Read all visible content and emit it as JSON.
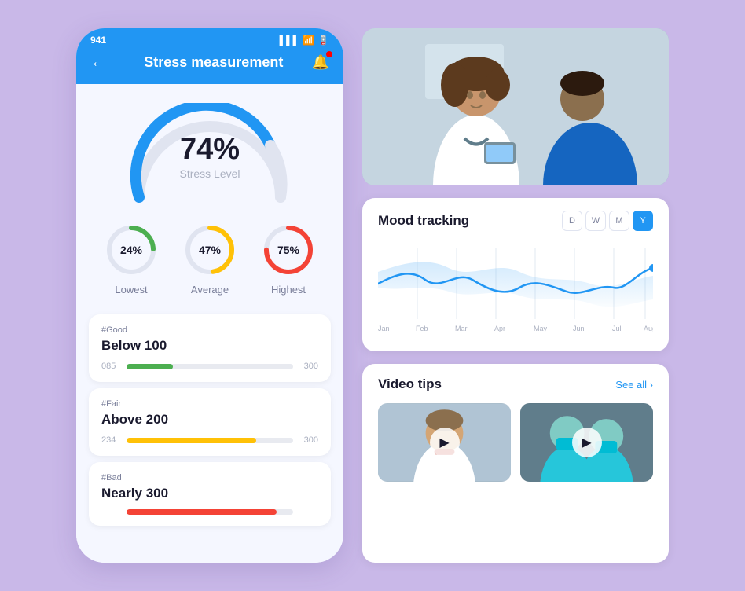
{
  "phone": {
    "status_time": "941",
    "header_title": "Stress measurement",
    "stress_percent": "74%",
    "stress_label": "Stress Level",
    "lowest_value": "24%",
    "lowest_label": "Lowest",
    "average_value": "47%",
    "average_label": "Average",
    "highest_value": "75%",
    "highest_label": "Highest",
    "metrics": [
      {
        "tag": "#Good",
        "title": "Below 100",
        "min": "085",
        "max": "300",
        "fill_pct": 28,
        "color": "green"
      },
      {
        "tag": "#Fair",
        "title": "Above 200",
        "min": "234",
        "max": "300",
        "fill_pct": 78,
        "color": "yellow"
      },
      {
        "tag": "#Bad",
        "title": "Nearly 300",
        "min": "",
        "max": "",
        "fill_pct": 90,
        "color": "red"
      }
    ]
  },
  "mood": {
    "title": "Mood tracking",
    "tabs": [
      "D",
      "W",
      "M",
      "Y"
    ],
    "active_tab": "Y"
  },
  "video": {
    "title": "Video tips",
    "see_all": "See all ›",
    "thumb1_label": "Doctor video 1",
    "thumb2_label": "Doctor video 2"
  }
}
